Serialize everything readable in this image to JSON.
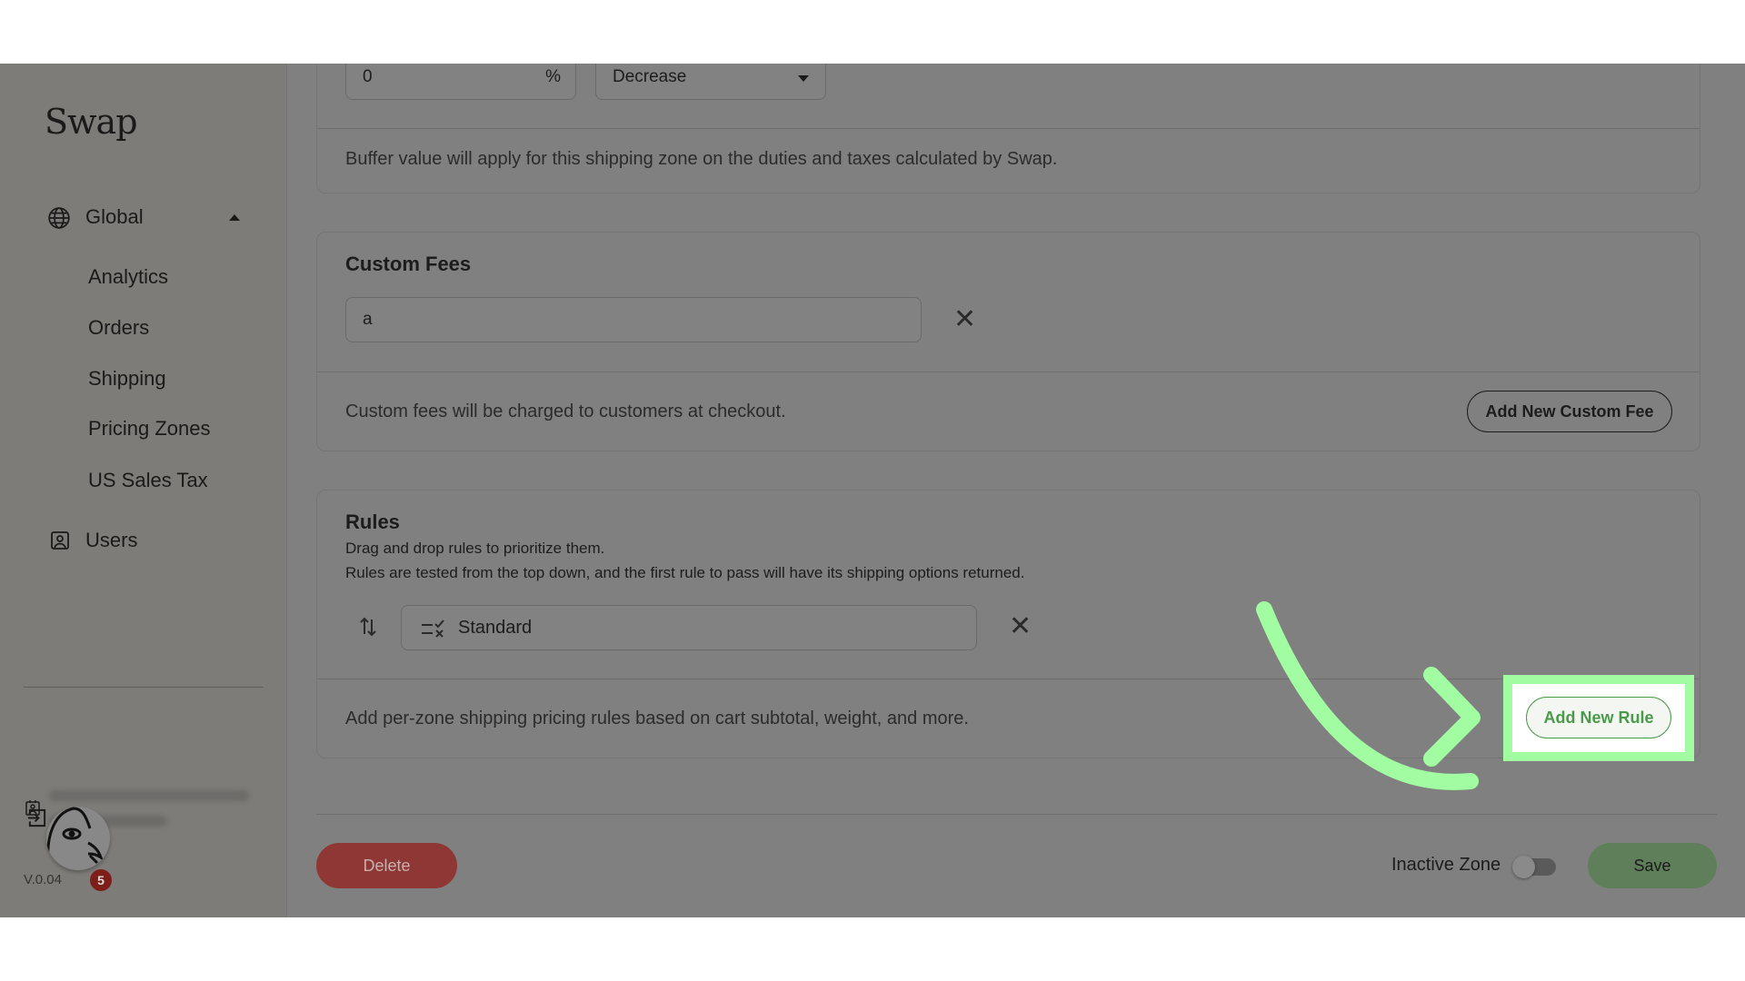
{
  "sidebar": {
    "logo": "Swap",
    "global_label": "Global",
    "items": [
      {
        "label": "Analytics"
      },
      {
        "label": "Orders"
      },
      {
        "label": "Shipping"
      },
      {
        "label": "Pricing Zones"
      },
      {
        "label": "US Sales Tax"
      }
    ],
    "users_label": "Users",
    "notification_count": "5",
    "version": "V.0.04"
  },
  "buffer": {
    "value": "0",
    "unit": "%",
    "direction": "Decrease",
    "help": "Buffer value will apply for this shipping zone on the duties and taxes calculated by Swap."
  },
  "custom_fees": {
    "title": "Custom Fees",
    "fee_value": "a",
    "help": "Custom fees will be charged to customers at checkout.",
    "add_label": "Add New Custom Fee"
  },
  "rules": {
    "title": "Rules",
    "subtitle1": "Drag and drop rules to prioritize them.",
    "subtitle2": "Rules are tested from the top down, and the first rule to pass will have its shipping options returned.",
    "items": [
      {
        "name": "Standard"
      }
    ],
    "help": "Add per-zone shipping pricing rules based on cart subtotal, weight, and more.",
    "add_label": "Add New Rule"
  },
  "footer": {
    "delete_label": "Delete",
    "inactive_label": "Inactive Zone",
    "inactive_on": false,
    "save_label": "Save"
  },
  "colors": {
    "highlight": "#a2fca2",
    "accent_green": "#4a9a4a",
    "delete": "#8e3734",
    "save": "#5f7f5a"
  }
}
